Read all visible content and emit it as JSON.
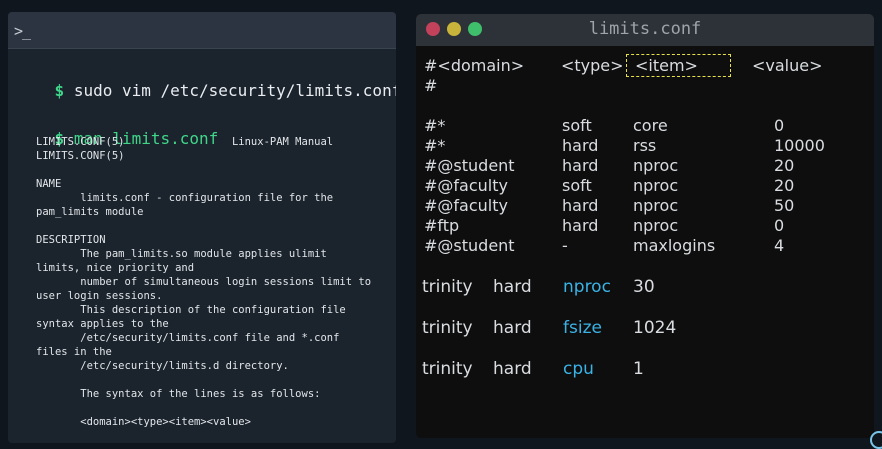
{
  "terminal": {
    "prompt_icon": ">_",
    "dollar": "$",
    "command1": "sudo vim /etc/security/limits.conf",
    "command2": "man limits.conf",
    "man_page": [
      "LIMITS.CONF(5)                 Linux-PAM Manual",
      "LIMITS.CONF(5)",
      "",
      "NAME",
      "       limits.conf - configuration file for the",
      "pam_limits module",
      "",
      "DESCRIPTION",
      "       The pam_limits.so module applies ulimit",
      "limits, nice priority and",
      "       number of simultaneous login sessions limit to",
      "user login sessions.",
      "       This description of the configuration file",
      "syntax applies to the",
      "       /etc/security/limits.conf file and *.conf",
      "files in the",
      "       /etc/security/limits.d directory.",
      "",
      "       The syntax of the lines is as follows:",
      "",
      "       <domain><type><item><value>"
    ]
  },
  "editor": {
    "title": "limits.conf",
    "header": {
      "domain": "#<domain>",
      "type": "<type>",
      "item": "<item>",
      "value": "<value>"
    },
    "hash": "#",
    "comment_rows": [
      {
        "domain": "#*",
        "type": "soft",
        "item": "core",
        "value": "0"
      },
      {
        "domain": "#*",
        "type": "hard",
        "item": "rss",
        "value": "10000"
      },
      {
        "domain": "#@student",
        "type": "hard",
        "item": "nproc",
        "value": "20"
      },
      {
        "domain": "#@faculty",
        "type": "soft",
        "item": "nproc",
        "value": "20"
      },
      {
        "domain": "#@faculty",
        "type": "hard",
        "item": "nproc",
        "value": "50"
      },
      {
        "domain": "#ftp",
        "type": "hard",
        "item": "nproc",
        "value": "0"
      },
      {
        "domain": "#@student",
        "type": "-",
        "item": "maxlogins",
        "value": "4"
      }
    ],
    "entries": [
      {
        "domain": "trinity",
        "type": "hard",
        "item": "nproc",
        "value": "30"
      },
      {
        "domain": "trinity",
        "type": "hard",
        "item": "fsize",
        "value": "1024"
      },
      {
        "domain": "trinity",
        "type": "hard",
        "item": "cpu",
        "value": "1"
      }
    ]
  },
  "colors": {
    "item_highlight": "#3ab3e6",
    "prompt_green": "#3fd68a",
    "box_border": "#e9e246"
  }
}
